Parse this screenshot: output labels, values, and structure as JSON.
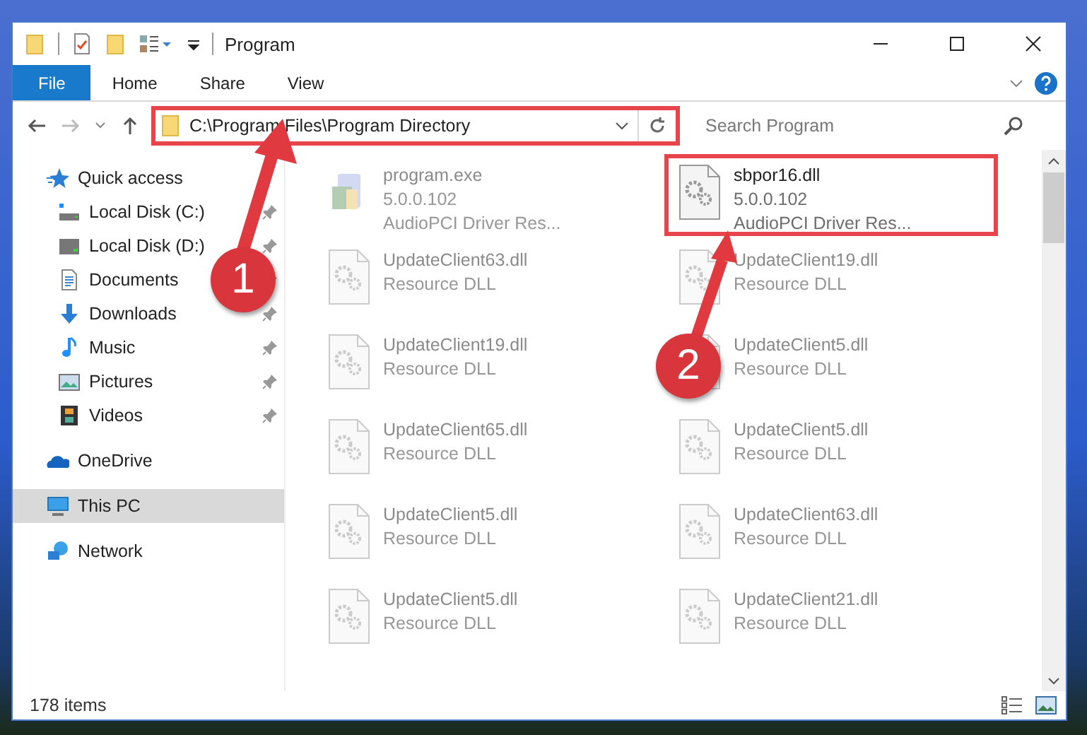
{
  "window": {
    "title": "Program"
  },
  "ribbon": {
    "tabs": [
      {
        "label": "File",
        "selected": true
      },
      {
        "label": "Home",
        "selected": false
      },
      {
        "label": "Share",
        "selected": false
      },
      {
        "label": "View",
        "selected": false
      }
    ]
  },
  "address": {
    "path": "C:\\Program Files\\Program Directory",
    "highlighted": true
  },
  "search": {
    "placeholder": "Search Program"
  },
  "sidebar": {
    "items": [
      {
        "label": "Quick access",
        "kind": "star",
        "selected": false,
        "children": [
          {
            "label": "Local Disk (C:)",
            "kind": "disk-c",
            "pinned": true
          },
          {
            "label": "Local Disk (D:)",
            "kind": "disk",
            "pinned": true
          },
          {
            "label": "Documents",
            "kind": "documents",
            "pinned": true
          },
          {
            "label": "Downloads",
            "kind": "downloads",
            "pinned": true
          },
          {
            "label": "Music",
            "kind": "music",
            "pinned": true
          },
          {
            "label": "Pictures",
            "kind": "pictures",
            "pinned": true
          },
          {
            "label": "Videos",
            "kind": "videos",
            "pinned": true
          }
        ]
      },
      {
        "label": "OneDrive",
        "kind": "cloud",
        "selected": false
      },
      {
        "label": "This PC",
        "kind": "pc",
        "selected": true
      },
      {
        "label": "Network",
        "kind": "network",
        "selected": false
      }
    ]
  },
  "files": [
    {
      "name": "program.exe",
      "details": [
        "5.0.0.102",
        "AudioPCI Driver Res..."
      ],
      "kind": "exe",
      "blurred": true,
      "highlighted": false
    },
    {
      "name": "sbpor16.dll",
      "details": [
        "5.0.0.102",
        "AudioPCI Driver Res..."
      ],
      "kind": "dll",
      "blurred": false,
      "highlighted": true
    },
    {
      "name": "UpdateClient63.dll",
      "details": [
        "Resource DLL"
      ],
      "kind": "dll",
      "blurred": true,
      "highlighted": false
    },
    {
      "name": "UpdateClient19.dll",
      "details": [
        "Resource DLL"
      ],
      "kind": "dll",
      "blurred": true,
      "highlighted": false
    },
    {
      "name": "UpdateClient19.dll",
      "details": [
        "Resource DLL"
      ],
      "kind": "dll",
      "blurred": true,
      "highlighted": false
    },
    {
      "name": "UpdateClient5.dll",
      "details": [
        "Resource DLL"
      ],
      "kind": "dll",
      "blurred": true,
      "highlighted": false
    },
    {
      "name": "UpdateClient65.dll",
      "details": [
        "Resource DLL"
      ],
      "kind": "dll",
      "blurred": true,
      "highlighted": false
    },
    {
      "name": "UpdateClient5.dll",
      "details": [
        "Resource DLL"
      ],
      "kind": "dll",
      "blurred": true,
      "highlighted": false
    },
    {
      "name": "UpdateClient5.dll",
      "details": [
        "Resource DLL"
      ],
      "kind": "dll",
      "blurred": true,
      "highlighted": false
    },
    {
      "name": "UpdateClient63.dll",
      "details": [
        "Resource DLL"
      ],
      "kind": "dll",
      "blurred": true,
      "highlighted": false
    },
    {
      "name": "UpdateClient5.dll",
      "details": [
        "Resource DLL"
      ],
      "kind": "dll",
      "blurred": true,
      "highlighted": false
    },
    {
      "name": "UpdateClient21.dll",
      "details": [
        "Resource DLL"
      ],
      "kind": "dll",
      "blurred": true,
      "highlighted": false
    }
  ],
  "status_bar": {
    "count": "178 items"
  },
  "annotations": [
    {
      "label": "1"
    },
    {
      "label": "2"
    }
  ]
}
